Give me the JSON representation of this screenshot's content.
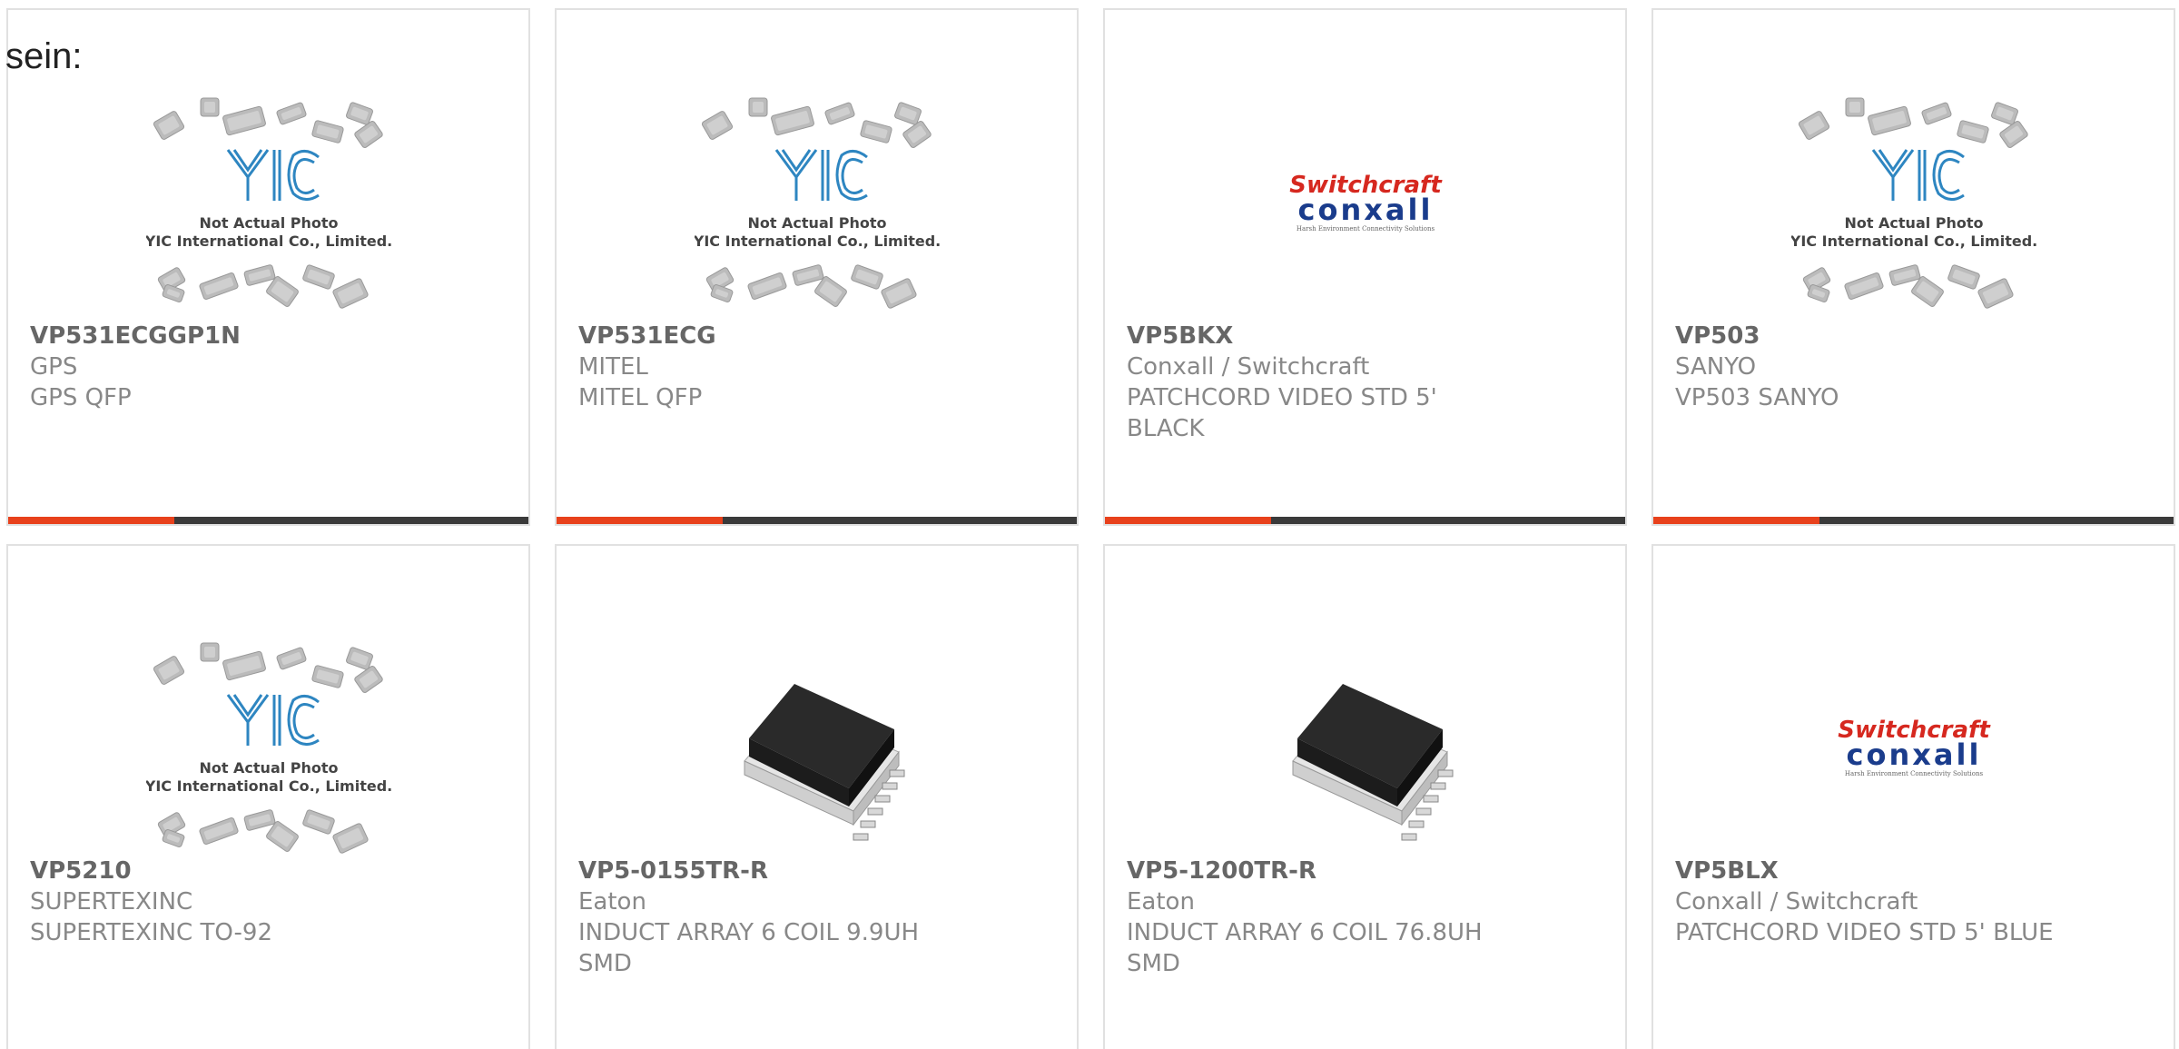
{
  "intro_text": "sein:",
  "placeholder": {
    "line1": "Not Actual Photo",
    "line2": "YIC International Co., Limited.",
    "logo": "YIC"
  },
  "brand_logo": {
    "top": "Switchcraft",
    "bottom": "conxall",
    "tagline": "Harsh Environment Connectivity Solutions",
    "accent_color": "#d6281f",
    "secondary_color": "#1a3c8c"
  },
  "colors": {
    "accent_bar": "#e8411c",
    "bar": "#3a3a3a",
    "yic_blue": "#2e86c1"
  },
  "products": [
    {
      "part": "VP531ECGGP1N",
      "manufacturer": "GPS",
      "description": "GPS QFP",
      "image": "yic-placeholder"
    },
    {
      "part": "VP531ECG",
      "manufacturer": "MITEL",
      "description": "MITEL QFP",
      "image": "yic-placeholder"
    },
    {
      "part": "VP5BKX",
      "manufacturer": "Conxall / Switchcraft",
      "description": "PATCHCORD VIDEO STD 5' BLACK",
      "image": "switchcraft-logo"
    },
    {
      "part": "VP503",
      "manufacturer": "SANYO",
      "description": "VP503 SANYO",
      "image": "yic-placeholder"
    },
    {
      "part": "VP5210",
      "manufacturer": "SUPERTEXINC",
      "description": "SUPERTEXINC TO-92",
      "image": "yic-placeholder"
    },
    {
      "part": "VP5-0155TR-R",
      "manufacturer": "Eaton",
      "description": "INDUCT ARRAY 6 COIL 9.9UH SMD",
      "image": "inductor-photo"
    },
    {
      "part": "VP5-1200TR-R",
      "manufacturer": "Eaton",
      "description": "INDUCT ARRAY 6 COIL 76.8UH SMD",
      "image": "inductor-photo"
    },
    {
      "part": "VP5BLX",
      "manufacturer": "Conxall / Switchcraft",
      "description": "PATCHCORD VIDEO STD 5' BLUE",
      "image": "switchcraft-logo"
    }
  ]
}
